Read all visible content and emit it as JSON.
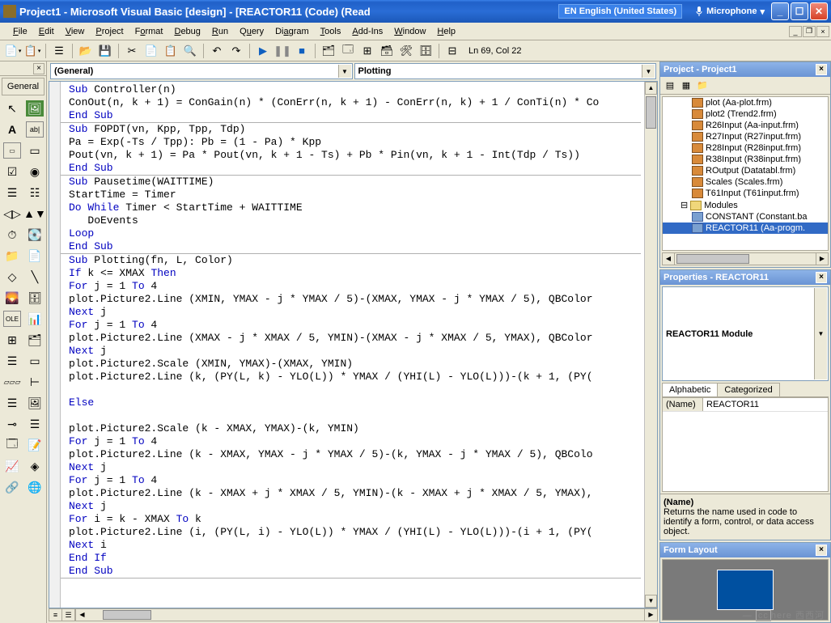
{
  "title": "Project1 - Microsoft Visual Basic [design] - [REACTOR11 (Code)  (Read",
  "lang": "EN English (United States)",
  "mic": "Microphone",
  "menu": [
    "File",
    "Edit",
    "View",
    "Project",
    "Format",
    "Debug",
    "Run",
    "Query",
    "Diagram",
    "Tools",
    "Add-Ins",
    "Window",
    "Help"
  ],
  "cursor": "Ln 69, Col 22",
  "toolbox_tab": "General",
  "combo": {
    "object": "(General)",
    "proc": "Plotting"
  },
  "code": {
    "l1a": "Sub",
    "l1b": " Controller(n)",
    "l2": "ConOut(n, k + 1) = ConGain(n) * (ConErr(n, k + 1) - ConErr(n, k) + 1 / ConTi(n) * Co",
    "l3": "End Sub",
    "l4a": "Sub",
    "l4b": " FOPDT(vn, Kpp, Tpp, Tdp)",
    "l5": "Pa = Exp(-Ts / Tpp): Pb = (1 - Pa) * Kpp",
    "l6": "Pout(vn, k + 1) = Pa * Pout(vn, k + 1 - Ts) + Pb * Pin(vn, k + 1 - Int(Tdp / Ts))",
    "l7": "End Sub",
    "l8a": "Sub",
    "l8b": " Pausetime(WAITTIME)",
    "l9": "StartTime = Timer",
    "l10a": "Do While",
    "l10b": " Timer < StartTime + WAITTIME",
    "l11": "   DoEvents",
    "l12": "Loop",
    "l13": "End Sub",
    "l14a": "Sub",
    "l14b": " Plotting(fn, L, Color)",
    "l15a": "If",
    "l15b": " k <= XMAX ",
    "l15c": "Then",
    "l16a": "For",
    "l16b": " j = 1 ",
    "l16c": "To",
    "l16d": " 4",
    "l17": "plot.Picture2.Line (XMIN, YMAX - j * YMAX / 5)-(XMAX, YMAX - j * YMAX / 5), QBColor",
    "l18a": "Next",
    "l18b": " j",
    "l19a": "For",
    "l19b": " j = 1 ",
    "l19c": "To",
    "l19d": " 4",
    "l20": "plot.Picture2.Line (XMAX - j * XMAX / 5, YMIN)-(XMAX - j * XMAX / 5, YMAX), QBColor",
    "l21a": "Next",
    "l21b": " j",
    "l22": "plot.Picture2.Scale (XMIN, YMAX)-(XMAX, YMIN)",
    "l23": "plot.Picture2.Line (k, (PY(L, k) - YLO(L)) * YMAX / (YHI(L) - YLO(L)))-(k + 1, (PY(",
    "l24": "  ",
    "l25": "Else",
    "l26": "  ",
    "l27": "plot.Picture2.Scale (k - XMAX, YMAX)-(k, YMIN)",
    "l28a": "For",
    "l28b": " j = 1 ",
    "l28c": "To",
    "l28d": " 4",
    "l29": "plot.Picture2.Line (k - XMAX, YMAX - j * YMAX / 5)-(k, YMAX - j * YMAX / 5), QBColo",
    "l30a": "Next",
    "l30b": " j",
    "l31a": "For",
    "l31b": " j = 1 ",
    "l31c": "To",
    "l31d": " 4",
    "l32": "plot.Picture2.Line (k - XMAX + j * XMAX / 5, YMIN)-(k - XMAX + j * XMAX / 5, YMAX),",
    "l33a": "Next",
    "l33b": " j",
    "l34a": "For",
    "l34b": " i = k - XMAX ",
    "l34c": "To",
    "l34d": " k",
    "l35": "plot.Picture2.Line (i, (PY(L, i) - YLO(L)) * YMAX / (YHI(L) - YLO(L)))-(i + 1, (PY(",
    "l36a": "Next",
    "l36b": " i",
    "l37": "End If",
    "l38": "End Sub"
  },
  "project": {
    "title": "Project - Project1",
    "items": [
      "plot (Aa-plot.frm)",
      "plot2 (Trend2.frm)",
      "R26Input (Aa-input.frm)",
      "R27Input (R27input.frm)",
      "R28Input (R28input.frm)",
      "R38Input (R38input.frm)",
      "ROutput (Datatabl.frm)",
      "Scales (Scales.frm)",
      "T61Input (T61input.frm)"
    ],
    "modules_label": "Modules",
    "modules": [
      "CONSTANT (Constant.ba",
      "REACTOR11 (Aa-progm."
    ]
  },
  "props": {
    "title": "Properties - REACTOR11",
    "object": "REACTOR11",
    "object_type": " Module",
    "tabs": [
      "Alphabetic",
      "Categorized"
    ],
    "name_label": "(Name)",
    "name_value": "REACTOR11",
    "desc_title": "(Name)",
    "desc_body": "Returns the name used in code to identify a form, control, or data access object."
  },
  "formlayout": {
    "title": "Form Layout"
  },
  "watermark": {
    "cc": "cc",
    "here": "here",
    "zh": "西西河"
  }
}
